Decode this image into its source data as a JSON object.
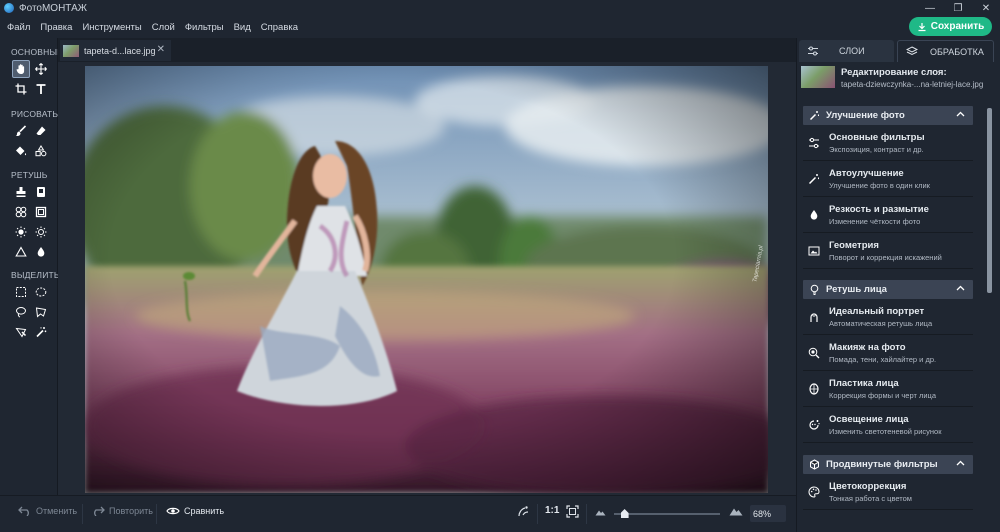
{
  "app": {
    "title": "ФотоМОНТАЖ"
  },
  "window_controls": {
    "minimize": "—",
    "restore": "❐",
    "close": "✕"
  },
  "menu": [
    "Файл",
    "Правка",
    "Инструменты",
    "Слой",
    "Фильтры",
    "Вид",
    "Справка"
  ],
  "save_button": {
    "label": "Сохранить"
  },
  "toolbar": {
    "sections": [
      "ОСНОВНЫЕ",
      "РИСОВАТЬ",
      "РЕТУШЬ",
      "ВЫДЕЛИТЬ"
    ]
  },
  "document_tab": {
    "title": "tapeta-d...lace.jpg",
    "close": "✕"
  },
  "photo": {
    "watermark": "Tapeciarnia.pl"
  },
  "bottom_bar": {
    "undo": "Отменить",
    "redo": "Повторить",
    "compare": "Сравнить",
    "ratio": "1:1",
    "zoom": "68%",
    "zoom_fraction": 0.1
  },
  "right_panel": {
    "tabs": [
      "СЛОИ",
      "ОБРАБОТКА"
    ],
    "layer": {
      "title": "Редактирование слоя:",
      "filename": "tapeta-dziewczynka-...na-letniej-lace.jpg"
    },
    "categories": [
      {
        "name": "Улучшение фото",
        "items": [
          {
            "title": "Основные фильтры",
            "subtitle": "Экспозиция, контраст и др."
          },
          {
            "title": "Автоулучшение",
            "subtitle": "Улучшение фото в один клик"
          },
          {
            "title": "Резкость и размытие",
            "subtitle": "Изменение чёткости фото"
          },
          {
            "title": "Геометрия",
            "subtitle": "Поворот и коррекция искажений"
          }
        ]
      },
      {
        "name": "Ретушь лица",
        "items": [
          {
            "title": "Идеальный портрет",
            "subtitle": "Автоматическая ретушь лица"
          },
          {
            "title": "Макияж на фото",
            "subtitle": "Помада, тени, хайлайтер и др."
          },
          {
            "title": "Пластика лица",
            "subtitle": "Коррекция формы и черт лица"
          },
          {
            "title": "Освещение лица",
            "subtitle": "Изменить светотеневой рисунок"
          }
        ]
      },
      {
        "name": "Продвинутые фильтры",
        "items": [
          {
            "title": "Цветокоррекция",
            "subtitle": "Тонкая работа с цветом"
          }
        ]
      }
    ]
  }
}
